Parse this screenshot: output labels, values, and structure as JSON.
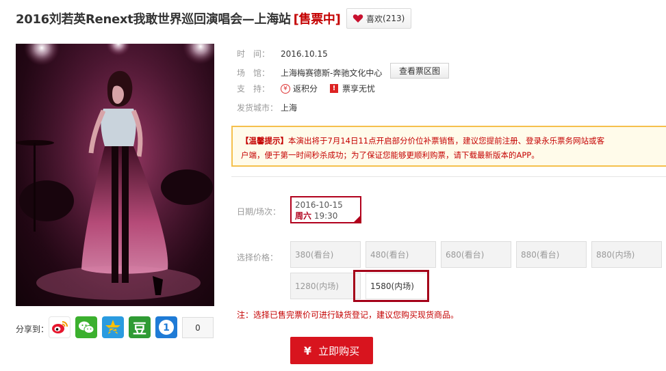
{
  "header": {
    "title": "2016刘若英Renext我敢世界巡回演唱会—上海站",
    "status": "[售票中]",
    "like_label": "喜欢",
    "like_count": "(213)"
  },
  "info": {
    "time_label": "时　间：",
    "time_value": "2016.10.15",
    "venue_label": "场　馆：",
    "venue_value": "上海梅赛德斯-奔驰文化中心",
    "view_map_label": "查看票区图",
    "support_label": "支　持：",
    "support_points": "返积分",
    "support_points_icon": "¥",
    "support_ticket": "票享无忧",
    "support_ticket_icon": "!",
    "ship_label": "发货城市：",
    "ship_value": "上海"
  },
  "notice": {
    "head": "【温馨提示】",
    "line1": "本演出将于7月14日11点开启部分价位补票销售，建议您提前注册、登录永乐票务网站或客",
    "line2": "户端，便于第一时间秒杀成功；为了保证您能够更顺利购票，请下载最新版本的APP。"
  },
  "session": {
    "label": "日期/场次：",
    "date": "2016-10-15",
    "weekday": "周六",
    "time": "19:30"
  },
  "prices": {
    "label": "选择价格：",
    "items": [
      {
        "label": "380(看台)",
        "available": false
      },
      {
        "label": "480(看台)",
        "available": false
      },
      {
        "label": "680(看台)",
        "available": false
      },
      {
        "label": "880(看台)",
        "available": false
      },
      {
        "label": "880(内场)",
        "available": false
      },
      {
        "label": "1280(内场)",
        "available": false
      },
      {
        "label": "1580(内场)",
        "available": true
      }
    ],
    "note": "注：选择已售完票价可进行缺货登记，建议您购买现货商品。"
  },
  "buy": {
    "icon": "¥",
    "label": "立即购买"
  },
  "share": {
    "label": "分享到：",
    "count": "0",
    "icons": [
      "weibo-icon",
      "wechat-icon",
      "qzone-icon",
      "douban-icon",
      "renren-icon"
    ]
  },
  "colors": {
    "accent_red": "#c40000",
    "buy_button": "#d8141e",
    "notice_border": "#f5c04c"
  }
}
